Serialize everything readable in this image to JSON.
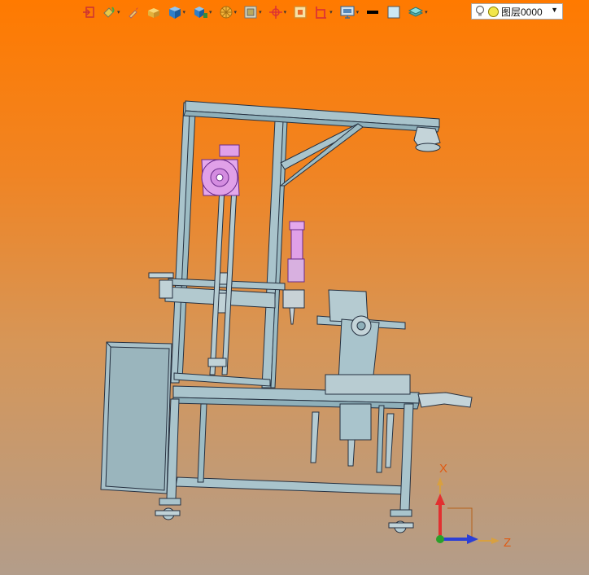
{
  "toolbar": {
    "buttons": [
      {
        "name": "import-icon",
        "color": "#d33"
      },
      {
        "name": "paint-bucket-icon",
        "color": "#4a4"
      },
      {
        "name": "brush-icon",
        "color": "#c66"
      },
      {
        "name": "box-solid-icon",
        "color": "#e3b23c"
      },
      {
        "name": "cube-icon",
        "color": "#2f7fc8"
      },
      {
        "name": "cube-view-icon",
        "color": "#2f7fc8"
      },
      {
        "name": "display-mode-icon",
        "color": "#e3a02a"
      },
      {
        "name": "render-style-icon",
        "color": "#999"
      },
      {
        "name": "origin-axes-icon",
        "color": "#d33"
      },
      {
        "name": "fit-view-icon",
        "color": "#d8892a"
      },
      {
        "name": "section-view-icon",
        "color": "#d33"
      },
      {
        "name": "monitor-icon",
        "color": "#5588bb"
      },
      {
        "name": "line-color-icon",
        "color": "#000000"
      },
      {
        "name": "fill-color-icon",
        "color": "#cce8f4"
      },
      {
        "name": "layer-icon",
        "color": "#5aa"
      }
    ]
  },
  "layer": {
    "current": "图层0000",
    "color": "#f2e64a"
  },
  "triad": {
    "x_label": "X",
    "z_label": "Z",
    "x_color": "#e23030",
    "z_color": "#2b3fd6",
    "y_color": "#2aa02a"
  },
  "scene": {
    "frame_color": "#a9c4cc",
    "edge_color": "#253040",
    "spring_color": "#e0a0e8",
    "cabinet_color": "#a9c4cc"
  }
}
